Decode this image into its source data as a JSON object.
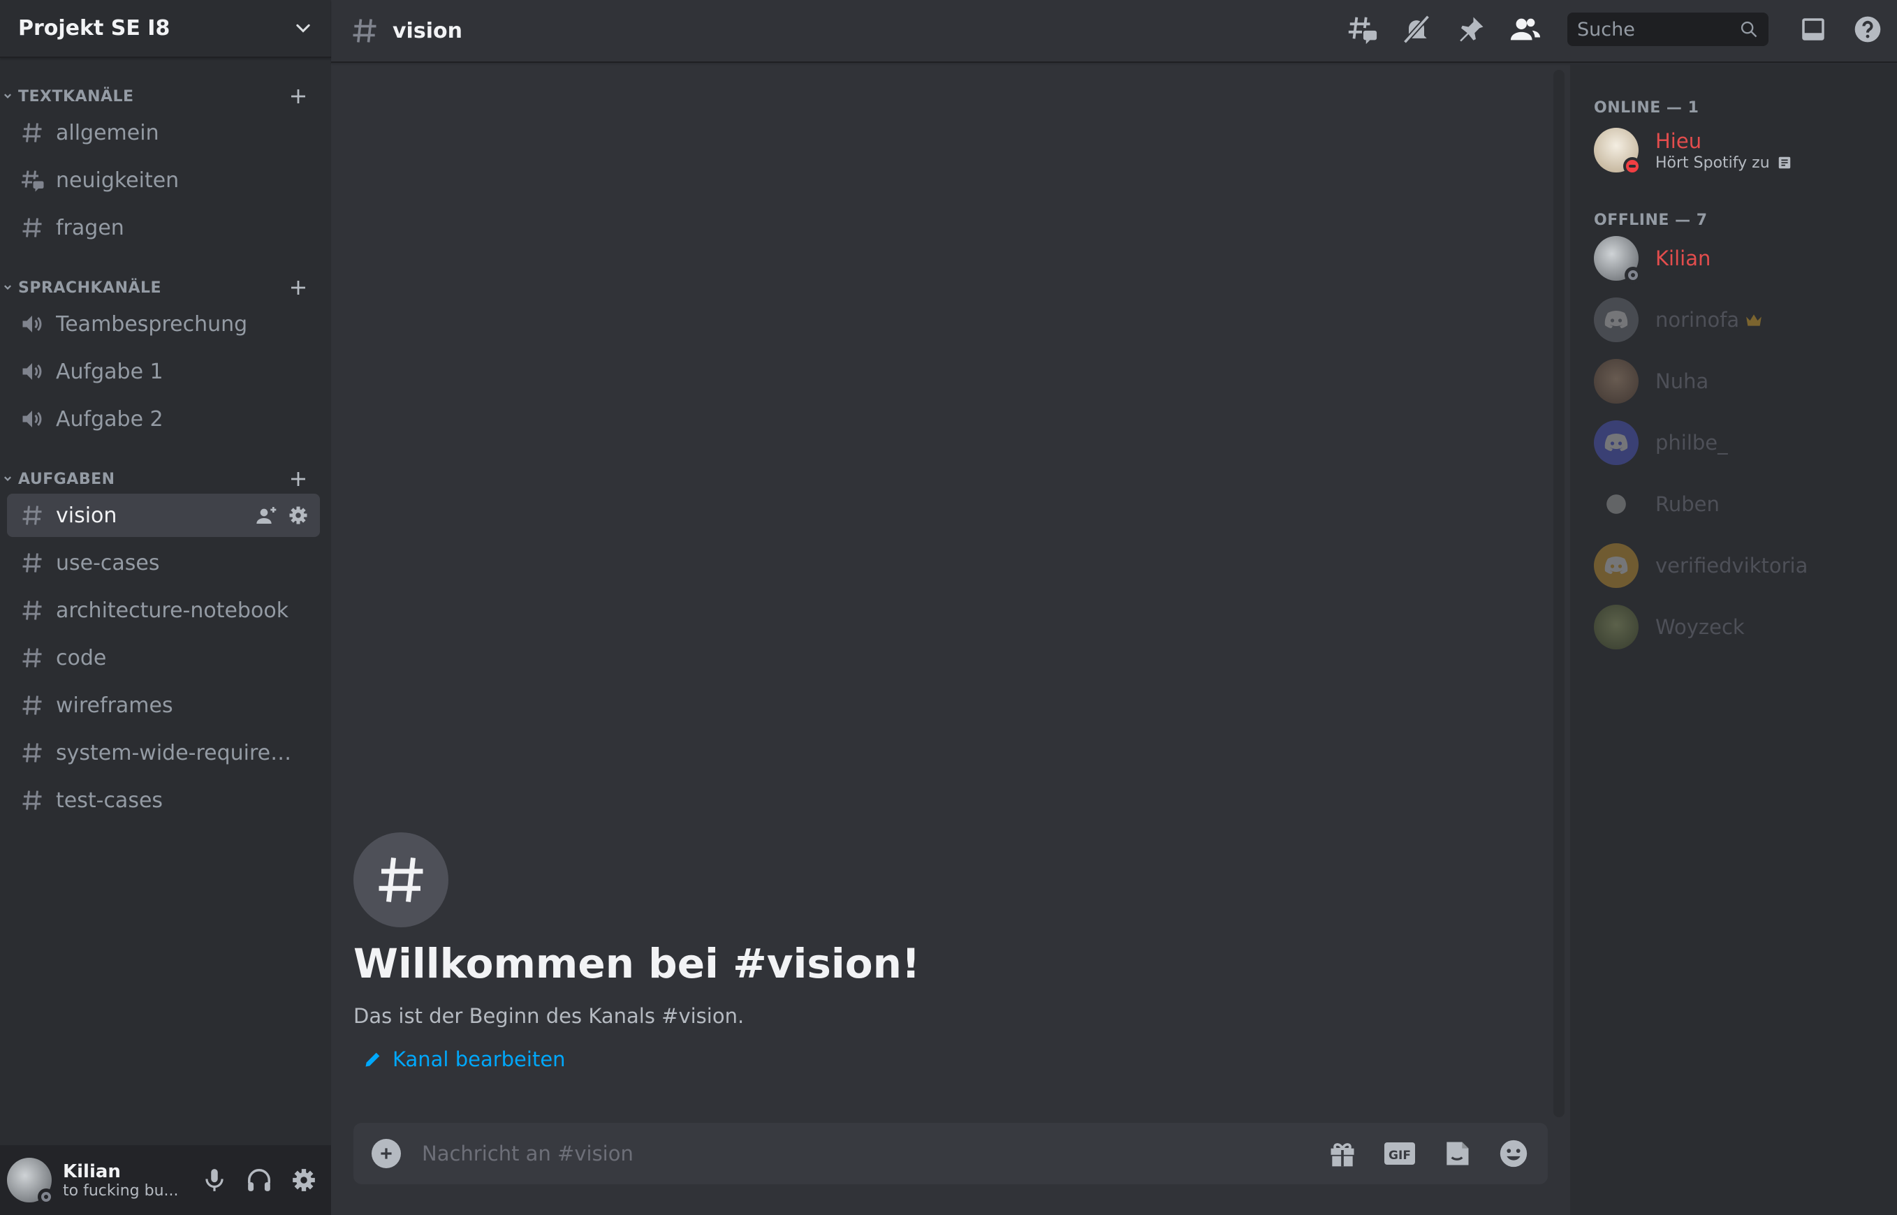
{
  "server": {
    "name": "Projekt SE I8"
  },
  "categories": [
    {
      "label": "TEXTKANÄLE",
      "channels": [
        "allgemein",
        "neuigkeiten",
        "fragen"
      ]
    },
    {
      "label": "SPRACHKANÄLE",
      "channels": [
        "Teambesprechung",
        "Aufgabe 1",
        "Aufgabe 2"
      ]
    },
    {
      "label": "AUFGABEN",
      "channels": [
        "vision",
        "use-cases",
        "architecture-notebook",
        "code",
        "wireframes",
        "system-wide-requirem...",
        "test-cases"
      ]
    }
  ],
  "current_channel": "vision",
  "search": {
    "placeholder": "Suche"
  },
  "welcome": {
    "title": "Willkommen bei #vision!",
    "subtitle": "Das ist der Beginn des Kanals #vision.",
    "edit_link": "Kanal bearbeiten"
  },
  "composer": {
    "placeholder": "Nachricht an #vision",
    "gif_label": "GIF"
  },
  "user": {
    "name": "Kilian",
    "status": "to fucking bu..."
  },
  "members": {
    "online_header": "ONLINE — 1",
    "offline_header": "OFFLINE — 7",
    "online": [
      {
        "name": "Hieu",
        "activity": "Hört Spotify zu"
      }
    ],
    "offline": [
      "Kilian",
      "norinofa",
      "Nuha",
      "philbe_",
      "Ruben",
      "verifiedviktoria",
      "Woyzeck"
    ]
  },
  "colors": {
    "accent_link": "#00a8fc",
    "dnd_red": "#f23f43",
    "name_red": "#e34d4d",
    "crown_gold": "#b08a2e"
  }
}
